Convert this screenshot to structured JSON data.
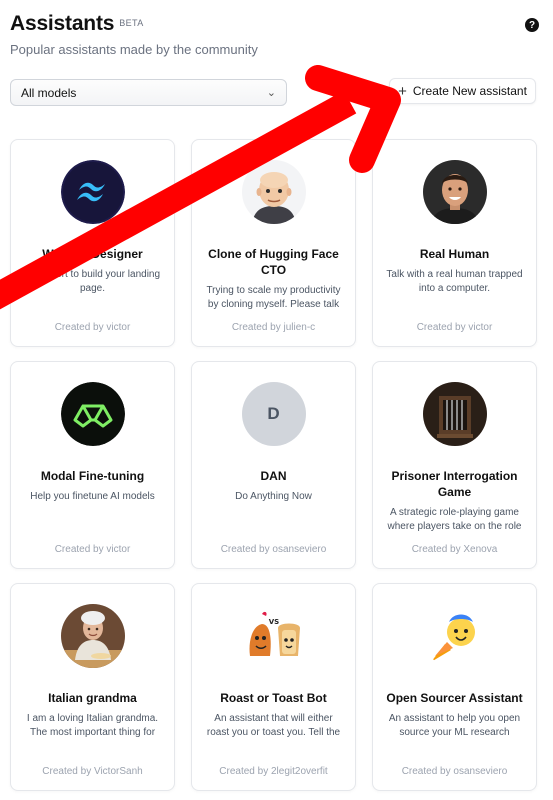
{
  "header": {
    "title": "Assistants",
    "badge": "BETA",
    "subtitle": "Popular assistants made by the community",
    "help_label": "?"
  },
  "filter": {
    "selected": "All models"
  },
  "create_button": {
    "label": "Create New assistant"
  },
  "assistants": [
    {
      "name": "Website Designer",
      "description": "An expert to build your landing page.",
      "author": "Created by victor",
      "avatar_icon": "tailwind-logo-icon"
    },
    {
      "name": "Clone of Hugging Face CTO",
      "description": "Trying to scale my productivity by cloning myself. Please talk to me",
      "author": "Created by julien-c",
      "avatar_icon": "cartoon-bald-man-avatar"
    },
    {
      "name": "Real Human",
      "description": "Talk with a real human trapped into a computer.",
      "author": "Created by victor",
      "avatar_icon": "smiling-man-photo"
    },
    {
      "name": "Modal Fine-tuning",
      "description": "Help you finetune AI models",
      "author": "Created by victor",
      "avatar_icon": "modal-logo-icon"
    },
    {
      "name": "DAN",
      "description": "Do Anything Now",
      "author": "Created by osanseviero",
      "avatar_icon": "letter-avatar",
      "avatar_letter": "D"
    },
    {
      "name": "Prisoner Interrogation Game",
      "description": "A strategic role-playing game where players take on the role of",
      "author": "Created by Xenova",
      "avatar_icon": "prison-cell-image"
    },
    {
      "name": "Italian grandma",
      "description": "I am a loving Italian grandma. The most important thing for me is",
      "author": "Created by VictorSanh",
      "avatar_icon": "grandma-cooking-photo"
    },
    {
      "name": "Roast or Toast Bot",
      "description": "An assistant that will either roast you or toast you. Tell the bot",
      "author": "Created by 2legit2overfit",
      "avatar_icon": "roast-vs-toast-icon"
    },
    {
      "name": "Open Sourcer Assistant",
      "description": "An assistant to help you open source your ML research",
      "author": "Created by osanseviero",
      "avatar_icon": "rocket-hugging-face-icon"
    }
  ],
  "colors": {
    "annotation_arrow": "#ff0000",
    "card_border": "#e5e7eb"
  }
}
